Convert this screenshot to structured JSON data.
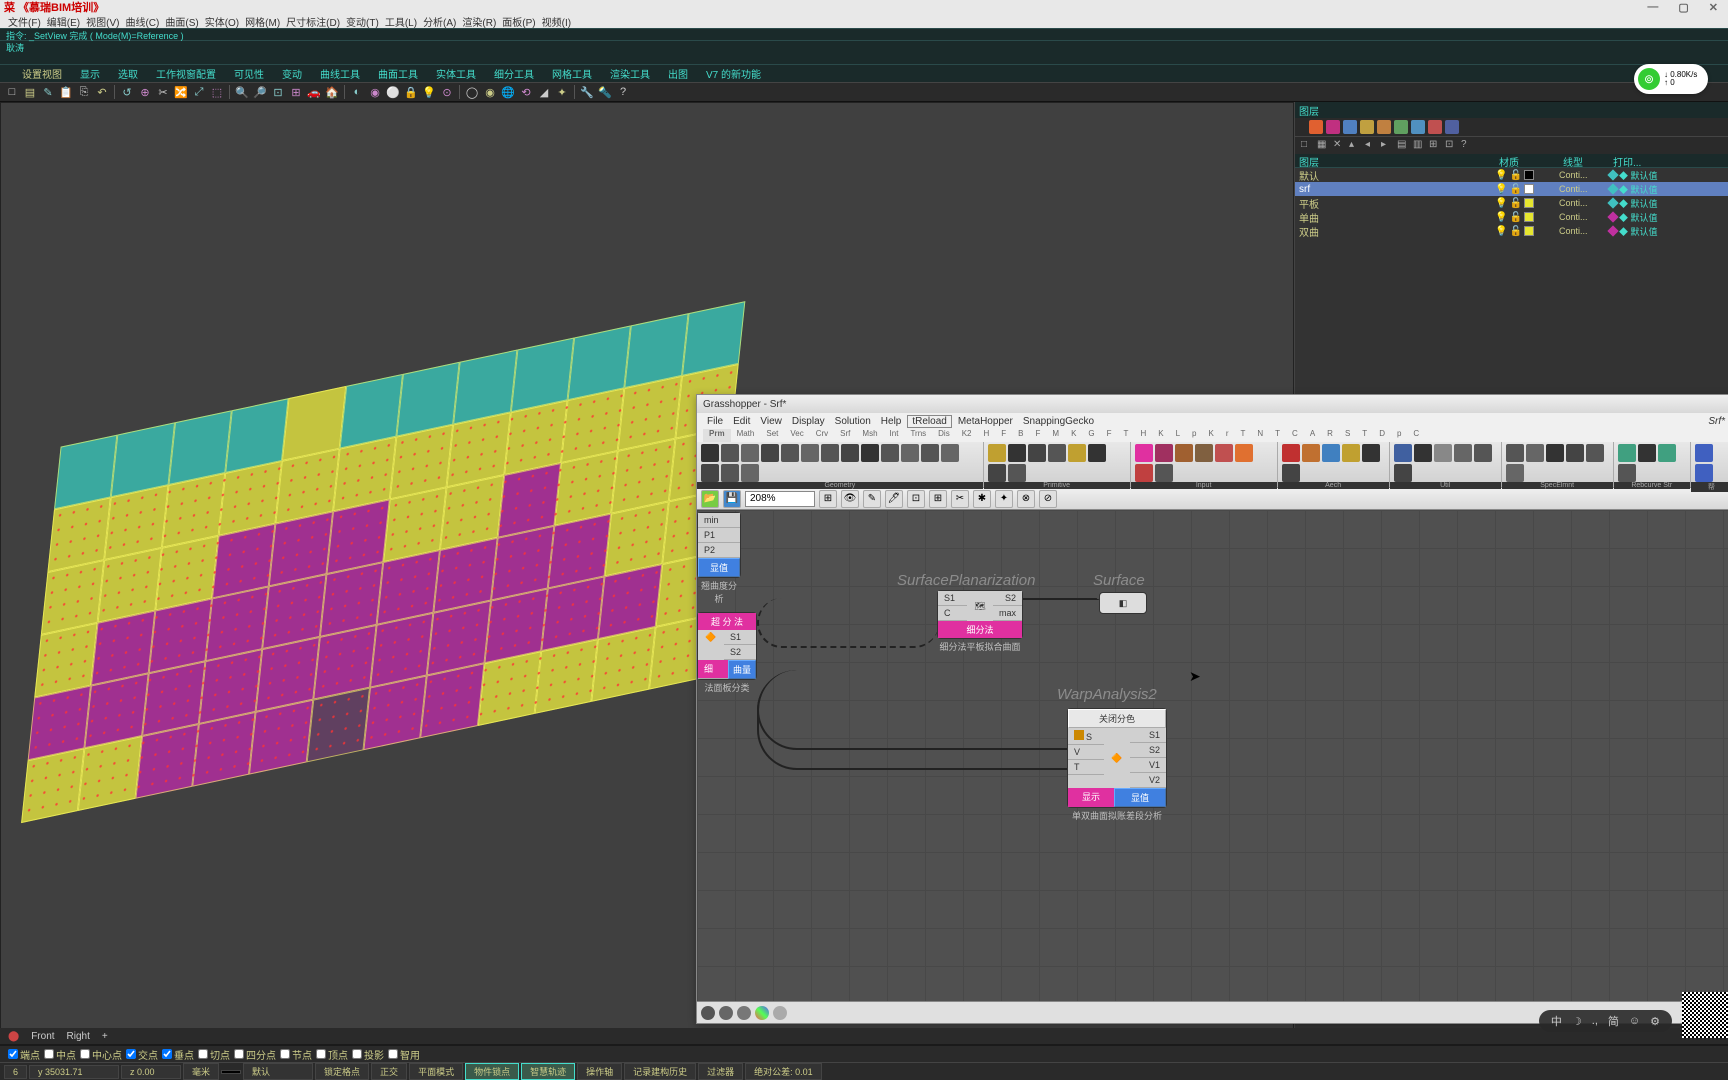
{
  "app": {
    "title_brand": "菜 《慕瑞BIM培训》",
    "win_buttons": [
      "—",
      "▢",
      "✕"
    ]
  },
  "menubar": [
    "文件(F)",
    "编辑(E)",
    "视图(V)",
    "曲线(C)",
    "曲面(S)",
    "实体(O)",
    "网格(M)",
    "尺寸标注(D)",
    "变动(T)",
    "工具(L)",
    "分析(A)",
    "渲染(R)",
    "面板(P)",
    "视频(I)"
  ],
  "command_hint": "指令: _SetView 完成 ( Mode(M)=Reference )",
  "command_prompt": "耿涛",
  "tabs": [
    "设置视图",
    "显示",
    "选取",
    "工作视窗配置",
    "可见性",
    "变动",
    "曲线工具",
    "曲面工具",
    "实体工具",
    "细分工具",
    "网格工具",
    "渲染工具",
    "出图",
    "V7 的新功能"
  ],
  "toolbar_icons": [
    "□",
    "▤",
    "✎",
    "📋",
    "⎘",
    "↶",
    "↺",
    "⊕",
    "✂",
    "🔀",
    "⤢",
    "⬚",
    "🔍",
    "🔎",
    "⊡",
    "⊞",
    "🚗",
    "🏠",
    "◐",
    "◉",
    "⚪",
    "🔒",
    "💡",
    "⊙",
    "◯",
    "◉",
    "🌐",
    "⟲",
    "◢",
    "✦",
    "🔧",
    "🔦",
    "?"
  ],
  "network": {
    "down": "↓ 0.80K/s",
    "up": "↑ 0"
  },
  "right_panel": {
    "header": "图层",
    "tab_icons": [
      "#e06030",
      "#c03080",
      "#5080c0",
      "#c0a040",
      "#c08040",
      "#60a060",
      "#5090c0",
      "#c05050",
      "#5060a0"
    ],
    "toolbar": [
      "□",
      "▦",
      "✕",
      "▴",
      "◂",
      "▸",
      "▤",
      "▥",
      "⊞",
      "⊡",
      "?"
    ],
    "columns": [
      "图层",
      "材质",
      "线型",
      "打印..."
    ],
    "layers": [
      {
        "name": "默认",
        "sel": false,
        "swatch": "#000",
        "lt": "Conti...",
        "dia": "#40c0c0",
        "pr": "◆ 默认值"
      },
      {
        "name": "srf",
        "sel": true,
        "swatch": "#fff",
        "lt": "Conti...",
        "dia": "#40c0c0",
        "pr": "◆ 默认值"
      },
      {
        "name": "平板",
        "sel": false,
        "swatch": "#e6e630",
        "lt": "Conti...",
        "dia": "#40c0c0",
        "pr": "◆ 默认值"
      },
      {
        "name": "单曲",
        "sel": false,
        "swatch": "#e6e630",
        "lt": "Conti...",
        "dia": "#c030a0",
        "pr": "◆ 默认值"
      },
      {
        "name": "双曲",
        "sel": false,
        "swatch": "#e6e630",
        "lt": "Conti...",
        "dia": "#c030a0",
        "pr": "◆ 默认值"
      }
    ]
  },
  "grasshopper": {
    "title": "Grasshopper - Srf*",
    "menu": [
      "File",
      "Edit",
      "View",
      "Display",
      "Solution",
      "Help"
    ],
    "menu_reload": "tReload",
    "menu_extra": [
      "MetaHopper",
      "SnappingGecko"
    ],
    "doc": "Srf*",
    "tabs": [
      "Prm",
      "Math",
      "Set",
      "Vec",
      "Crv",
      "Srf",
      "Msh",
      "Int",
      "Trns",
      "Dis",
      "K2",
      "H",
      "F",
      "B",
      "F",
      "M",
      "K",
      "G",
      "F",
      "T",
      "H",
      "K",
      "L",
      "p",
      "K",
      "r",
      "T",
      "N",
      "T",
      "C",
      "A",
      "R",
      "S",
      "T",
      "D",
      "p",
      "C"
    ],
    "ribbon_groups": [
      {
        "label": "Geometry",
        "n": 16,
        "colors": [
          "#333",
          "#555",
          "#666",
          "#444",
          "#555",
          "#666",
          "#555",
          "#444",
          "#333",
          "#555",
          "#666",
          "#555",
          "#666",
          "#444",
          "#555",
          "#666"
        ]
      },
      {
        "label": "Primitive",
        "n": 8,
        "colors": [
          "#c0a030",
          "#333",
          "#444",
          "#555",
          "#c0a030",
          "#333",
          "#444",
          "#555"
        ]
      },
      {
        "label": "Input",
        "n": 8,
        "colors": [
          "#e030a0",
          "#a03060",
          "#a06030",
          "#806040",
          "#c05050",
          "#e07030",
          "#c04040",
          "#555"
        ]
      },
      {
        "label": "Aech",
        "n": 6,
        "colors": [
          "#c03030",
          "#c07030",
          "#4080c0",
          "#c0a030",
          "#333",
          "#444"
        ]
      },
      {
        "label": "Util",
        "n": 6,
        "colors": [
          "#4060a0",
          "#333",
          "#888",
          "#666",
          "#555",
          "#444"
        ]
      },
      {
        "label": "SpecElmnt",
        "n": 6,
        "colors": [
          "#555",
          "#666",
          "#333",
          "#444",
          "#555",
          "#666"
        ]
      },
      {
        "label": "Rebcurve Str",
        "n": 4,
        "colors": [
          "#40a080",
          "#333",
          "#40a080",
          "#555"
        ]
      },
      {
        "label": "帮",
        "n": 2,
        "colors": [
          "#4060c0",
          "#4060c0"
        ]
      }
    ],
    "zoom": "208%",
    "tool2_icons": [
      "⊞",
      "👁",
      "✎",
      "🖊",
      "⊡",
      "⊞",
      "✂",
      "✱",
      "✦",
      "⊗",
      "⊘"
    ],
    "components": {
      "left_partial": {
        "ports": [
          "min",
          "P1",
          "P2"
        ],
        "btn": "显值",
        "caption": "翘曲度分析"
      },
      "classify": {
        "header": "超 分 法",
        "ports": [
          "S1",
          "S2"
        ],
        "out1": "细",
        "out2": "曲量",
        "caption": "法面板分类"
      },
      "planarize": {
        "label": "SurfacePlanarization",
        "in": [
          "S1",
          "C"
        ],
        "out": [
          "S2",
          "max"
        ],
        "footer": "细分法",
        "caption": "细分法平板拟合曲面"
      },
      "surface": {
        "label": "Surface"
      },
      "warp": {
        "label": "WarpAnalysis2",
        "btn": "关闭分色",
        "in": [
          "S",
          "V",
          "T"
        ],
        "out": [
          "S1",
          "S2",
          "V1",
          "V2"
        ],
        "foot1": "显示",
        "foot2": "显值",
        "caption": "单双曲面拟账差段分析"
      }
    }
  },
  "viewtabs": [
    "Front",
    "Right",
    "+"
  ],
  "osnap": [
    {
      "l": "端点",
      "c": true
    },
    {
      "l": "中点",
      "c": false
    },
    {
      "l": "中心点",
      "c": false
    },
    {
      "l": "交点",
      "c": true
    },
    {
      "l": "垂点",
      "c": true
    },
    {
      "l": "切点",
      "c": false
    },
    {
      "l": "四分点",
      "c": false
    },
    {
      "l": "节点",
      "c": false
    },
    {
      "l": "顶点",
      "c": false
    },
    {
      "l": "投影",
      "c": false
    },
    {
      "l": "智用",
      "c": false
    }
  ],
  "status": {
    "coords": [
      "6",
      "y 35031.71",
      "z 0.00"
    ],
    "unit": "毫米",
    "layer": "默认",
    "modes": [
      {
        "l": "锁定格点",
        "a": false
      },
      {
        "l": "正交",
        "a": false
      },
      {
        "l": "平面模式",
        "a": false
      },
      {
        "l": "物件锁点",
        "a": true
      },
      {
        "l": "智慧轨迹",
        "a": true
      },
      {
        "l": "操作轴",
        "a": false
      },
      {
        "l": "记录建构历史",
        "a": false
      },
      {
        "l": "过滤器",
        "a": false
      }
    ],
    "tol": "绝对公差: 0.01"
  },
  "ime": [
    "中",
    "☽",
    ".,",
    "简",
    "☺",
    "⚙"
  ]
}
